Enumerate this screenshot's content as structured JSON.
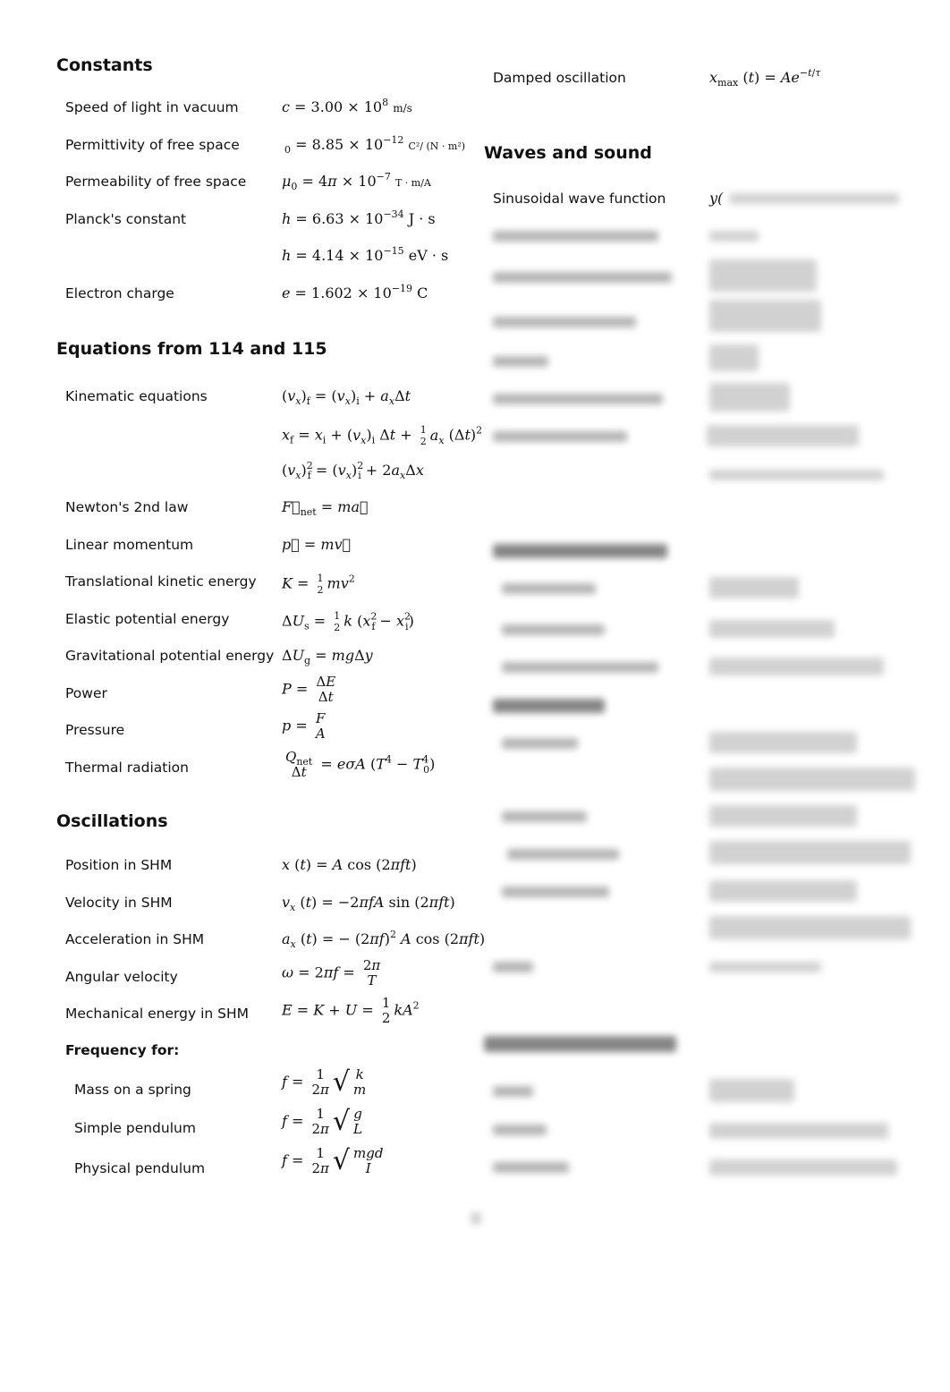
{
  "left_column": {
    "constants": {
      "title": "Constants",
      "rows": [
        {
          "label": "Speed of light in vacuum",
          "eq": "c = 3.00 × 10^8 m/s"
        },
        {
          "label": "Permittivity of free space",
          "eq": "_0 = 8.85 × 10^−12 C²/(N · m²)"
        },
        {
          "label": "Permeability of free space",
          "eq": "μ_0 = 4π × 10^−7 T · m/A"
        },
        {
          "label": "Planck's constant",
          "eq": "h = 6.63 × 10^−34 J · s"
        },
        {
          "label": "",
          "eq": "h = 4.14 × 10^−15 eV · s"
        },
        {
          "label": "Electron charge",
          "eq": "e = 1.602 × 10^−19 C"
        }
      ]
    },
    "equations": {
      "title": "Equations from 114 and 115",
      "rows": [
        {
          "label": "Kinematic equations",
          "eq": "(v_x)_f = (v_x)_i + a_x Δt"
        },
        {
          "label": "",
          "eq": "x_f = x_i + (v_x)_i Δt + ½ a_x (Δt)²"
        },
        {
          "label": "",
          "eq": "(v_x)_f² = (v_x)_i² + 2 a_x Δx"
        },
        {
          "label": "Newton's 2nd law",
          "eq": "F⃗_net = m a⃗"
        },
        {
          "label": "Linear momentum",
          "eq": "p⃗ = m v⃗"
        },
        {
          "label": "Translational kinetic energy",
          "eq": "K = ½ m v²"
        },
        {
          "label": "Elastic potential energy",
          "eq": "ΔU_s = ½ k (x_f² − x_i²)"
        },
        {
          "label": "Gravitational potential energy",
          "eq": "ΔU_g = m g Δy"
        },
        {
          "label": "Power",
          "eq": "P = ΔE / Δt"
        },
        {
          "label": "Pressure",
          "eq": "p = F / A"
        },
        {
          "label": "Thermal radiation",
          "eq": "Q_net / Δt = e σ A (T⁴ − T_0⁴)"
        }
      ]
    },
    "oscillations": {
      "title": "Oscillations",
      "rows": [
        {
          "label": "Position in SHM",
          "eq": "x(t) = A cos(2π f t)"
        },
        {
          "label": "Velocity in SHM",
          "eq": "v_x(t) = −2π f A sin(2π f t)"
        },
        {
          "label": "Acceleration in SHM",
          "eq": "a_x(t) = −(2π f)² A cos(2π f t)"
        },
        {
          "label": "Angular velocity",
          "eq": "ω = 2π f = 2π / T"
        },
        {
          "label": "Mechanical energy in SHM",
          "eq": "E = K + U = ½ k A²"
        }
      ],
      "frequency_heading": "Frequency for:",
      "frequency_rows": [
        {
          "label": "Mass on a spring",
          "eq": "f = (1/2π) √(k/m)"
        },
        {
          "label": "Simple pendulum",
          "eq": "f = (1/2π) √(g/L)"
        },
        {
          "label": "Physical pendulum",
          "eq": "f = (1/2π) √(mgd/I)"
        }
      ]
    }
  },
  "right_column": {
    "damped": {
      "label": "Damped oscillation",
      "eq": "x_max(t) = A e^(−t/τ)"
    },
    "waves": {
      "title": "Waves and sound",
      "first_row": {
        "label": "Sinusoidal wave function",
        "eq_visible_prefix": "y("
      },
      "blurred_note": "remaining content blurred / unreadable"
    }
  }
}
